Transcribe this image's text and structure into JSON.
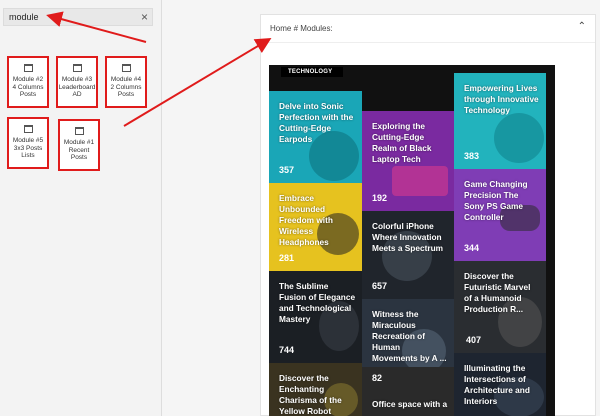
{
  "search": {
    "value": "module",
    "clear_icon": "×"
  },
  "modules": [
    {
      "label": "Module #2\n4 Columns\nPosts"
    },
    {
      "label": "Module #3\nLeaderboard\nAD"
    },
    {
      "label": "Module #4\n2 Columns\nPosts"
    },
    {
      "label": "Module #5\n3x3 Posts\nLists"
    },
    {
      "label": "Module #1\nRecent\nPosts"
    }
  ],
  "panel": {
    "breadcrumb": "Home # Modules:",
    "collapse_icon": "⌃"
  },
  "preview": {
    "section_title": "TECHNOLOGY",
    "tiles": [
      {
        "title": "Delve into Sonic Perfection with the Cutting-Edge Earpods",
        "count": "357",
        "color": "#1aa6b7"
      },
      {
        "title": "Exploring the Cutting-Edge Realm of Black Laptop Tech",
        "count": "192",
        "color": "#7a2aa0"
      },
      {
        "title": "Empowering Lives through Innovative Technology",
        "count": "383",
        "color": "#22b3bd"
      },
      {
        "title": "Embrace Unbounded Freedom with Wireless Headphones",
        "count": "281",
        "color": "#e6c21f"
      },
      {
        "title": "Colorful iPhone Where Innovation Meets a Spectrum",
        "count": "657",
        "color": "#20252c"
      },
      {
        "title": "Game Changing Precision The Sony PS Game Controller",
        "count": "344",
        "color": "#7f3db5"
      },
      {
        "title": "The Sublime Fusion of Elegance and Technological Mastery",
        "count": "744",
        "color": "#1b1f24"
      },
      {
        "title": "Witness the Miraculous Recreation of Human Movements by A ...",
        "count": "",
        "color": "#2b3440"
      },
      {
        "title": "Discover the Futuristic Marvel of a Humanoid Production R...",
        "count": "407",
        "color": "#2a2d31"
      },
      {
        "title": "Discover the Enchanting Charisma of the Yellow Robot",
        "count": "",
        "color": "#3a3320"
      },
      {
        "title": "Office space with a",
        "count": "82",
        "color": "#2a2a2a"
      },
      {
        "title": "Illuminating the Intersections of Architecture and Interiors",
        "count": "",
        "color": "#1e2530"
      }
    ]
  }
}
